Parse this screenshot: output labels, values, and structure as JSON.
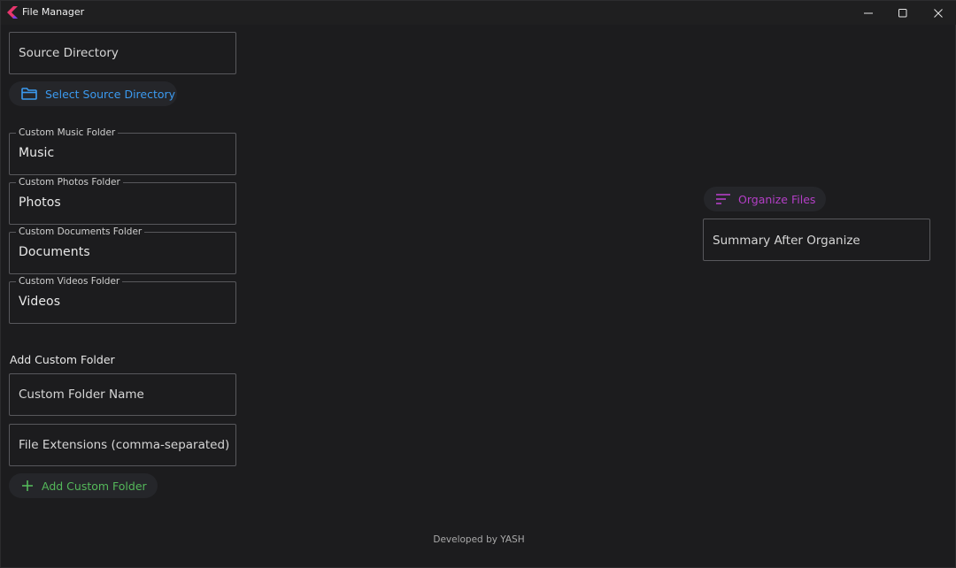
{
  "window": {
    "title": "File Manager",
    "logo_colors": [
      "#e8366d",
      "#7b3fe4"
    ]
  },
  "source": {
    "placeholder": "Source Directory",
    "select_button_label": "Select Source Directory",
    "select_icon": "folder-icon"
  },
  "custom_fields": [
    {
      "label": "Custom Music Folder",
      "value": "Music"
    },
    {
      "label": "Custom Photos Folder",
      "value": "Photos"
    },
    {
      "label": "Custom Documents Folder",
      "value": "Documents"
    },
    {
      "label": "Custom Videos Folder",
      "value": "Videos"
    }
  ],
  "add_custom": {
    "section_label": "Add Custom Folder",
    "name_placeholder": "Custom Folder Name",
    "extensions_placeholder": "File Extensions (comma-separated)",
    "button_label": "Add Custom Folder",
    "button_icon": "plus-icon"
  },
  "organize": {
    "button_label": "Organize Files",
    "button_icon": "sort-icon",
    "summary_placeholder": "Summary After Organize"
  },
  "footer": {
    "text": "Developed by YASH"
  },
  "colors": {
    "background": "#1c1c1e",
    "blue_accent": "#3b9af0",
    "green_accent": "#54b85a",
    "purple_accent": "#b43fc7"
  }
}
